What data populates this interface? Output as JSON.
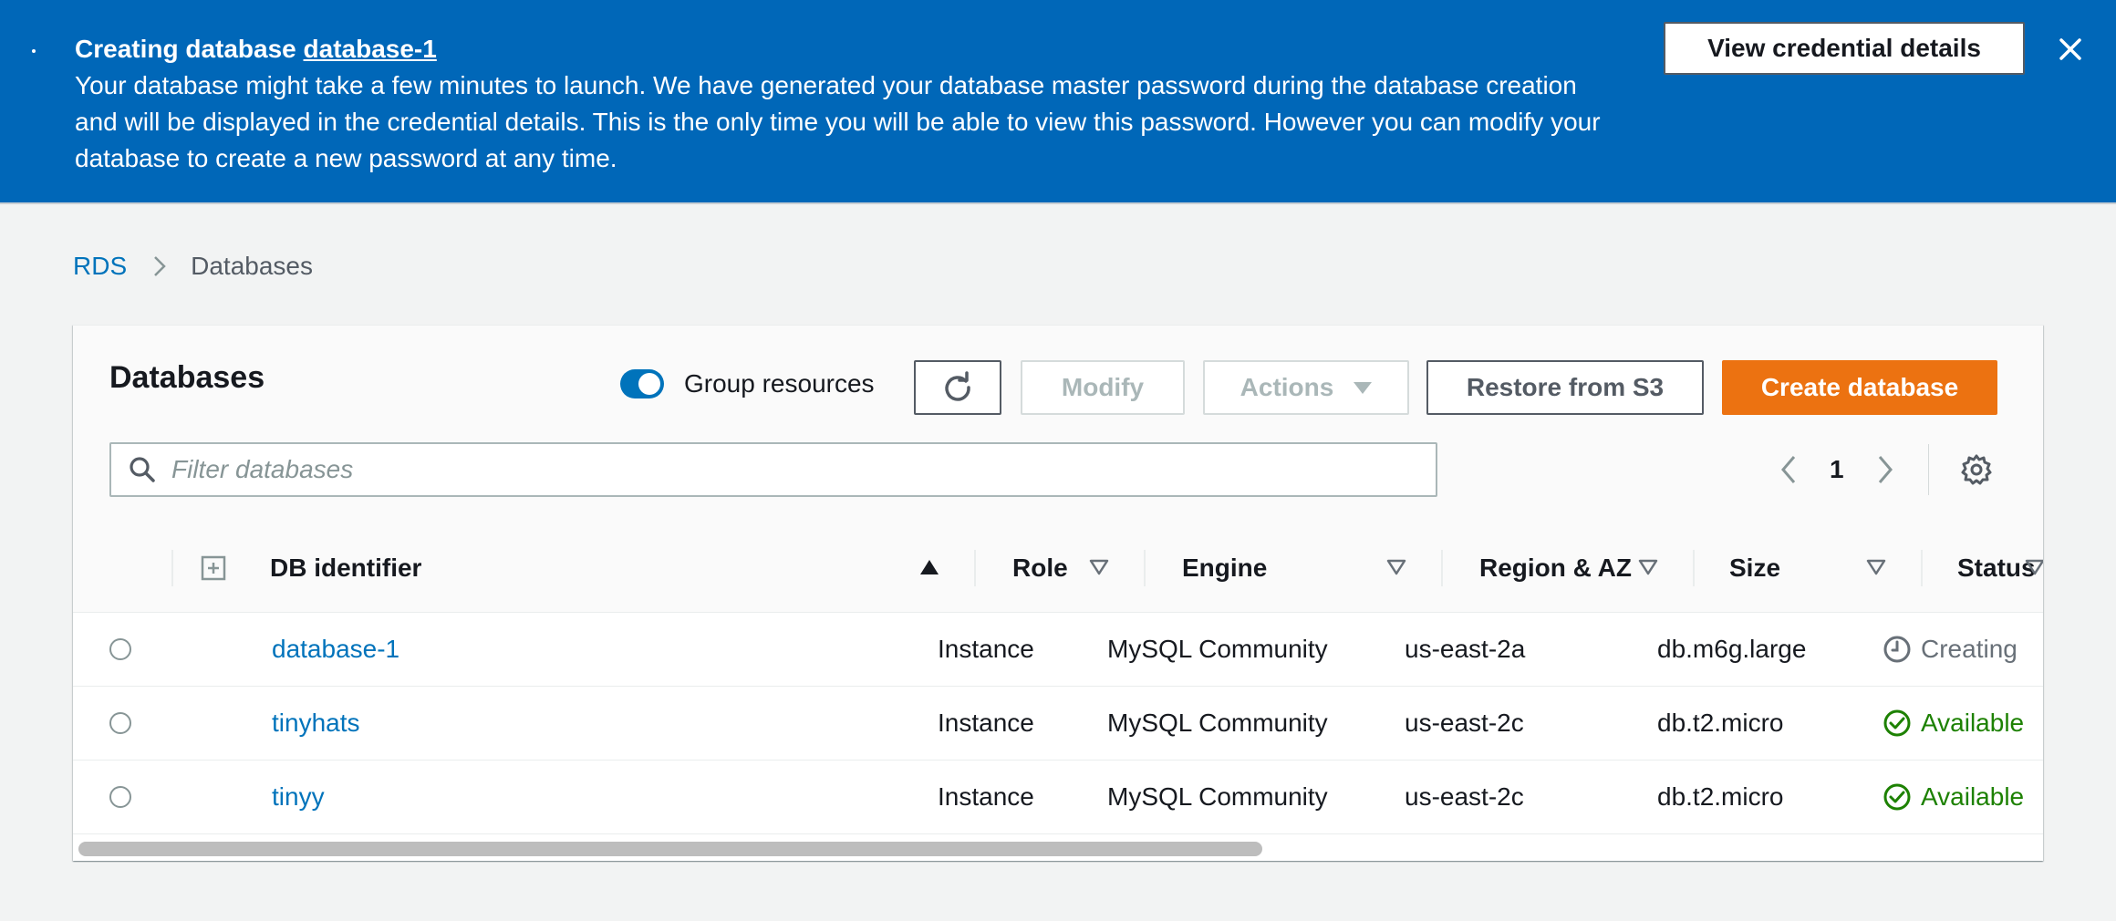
{
  "flash": {
    "title_prefix": "Creating database ",
    "title_link": "database-1",
    "message": "Your database might take a few minutes to launch. We have generated your database master password during the database creation and will be displayed in the credential details. This is the only time you will be able to view this password. However you can modify your database to create a new password at any time.",
    "view_credentials_label": "View credential details",
    "close_icon": "close-icon"
  },
  "breadcrumb": {
    "root": "RDS",
    "current": "Databases"
  },
  "panel": {
    "title": "Databases",
    "group_resources_label": "Group resources",
    "group_resources_on": true,
    "modify_label": "Modify",
    "actions_label": "Actions",
    "restore_label": "Restore from S3",
    "create_label": "Create database",
    "filter_placeholder": "Filter databases",
    "page": "1"
  },
  "columns": {
    "identifier": "DB identifier",
    "role": "Role",
    "engine": "Engine",
    "region": "Region & AZ",
    "size": "Size",
    "status": "Status"
  },
  "rows": [
    {
      "identifier": "database-1",
      "role": "Instance",
      "engine": "MySQL Community",
      "region": "us-east-2a",
      "size": "db.m6g.large",
      "status": "Creating",
      "status_kind": "creating"
    },
    {
      "identifier": "tinyhats",
      "role": "Instance",
      "engine": "MySQL Community",
      "region": "us-east-2c",
      "size": "db.t2.micro",
      "status": "Available",
      "status_kind": "available"
    },
    {
      "identifier": "tinyy",
      "role": "Instance",
      "engine": "MySQL Community",
      "region": "us-east-2c",
      "size": "db.t2.micro",
      "status": "Available",
      "status_kind": "available"
    }
  ],
  "colors": {
    "banner": "#0067b8",
    "link": "#0073bb",
    "primary_button": "#ec7211",
    "available": "#1d8102",
    "creating": "#687078"
  }
}
